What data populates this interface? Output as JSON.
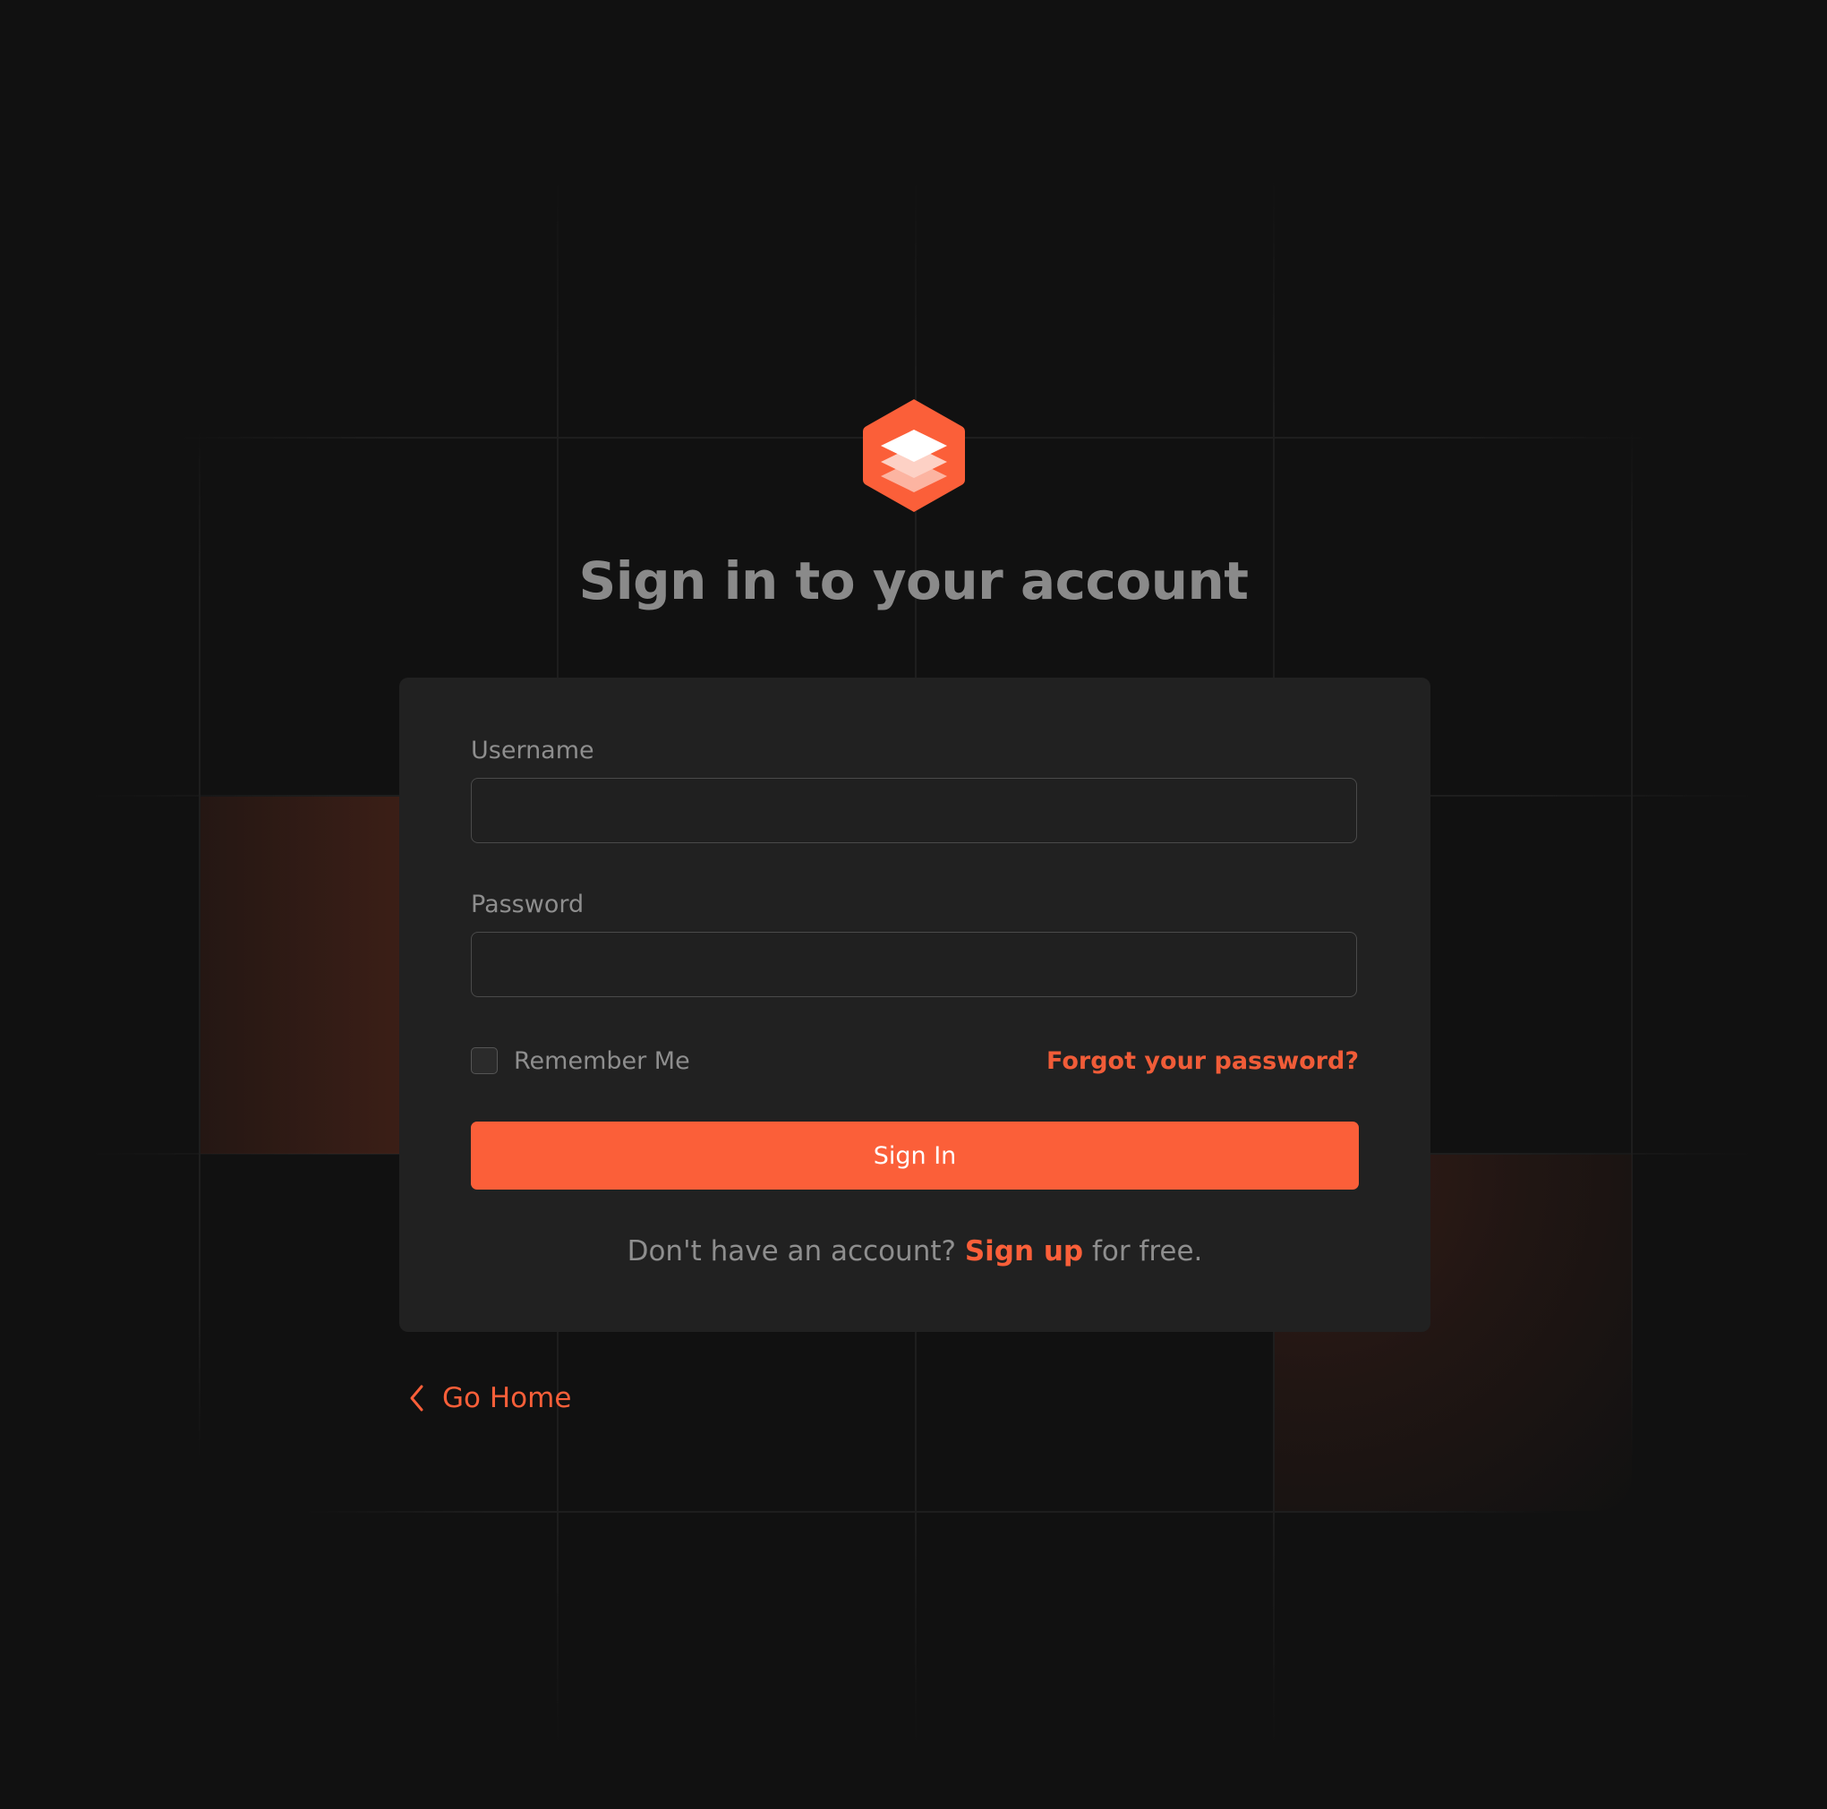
{
  "page": {
    "title": "Sign in to your account"
  },
  "logo": {
    "icon": "stacked-layers-hexagon-icon",
    "color": "#fb5f39"
  },
  "form": {
    "username_label": "Username",
    "username_value": "",
    "password_label": "Password",
    "password_value": "",
    "remember_label": "Remember Me",
    "remember_checked": false,
    "forgot_label": "Forgot your password?",
    "submit_label": "Sign In",
    "signup_prefix": "Don't have an account? ",
    "signup_link": "Sign up",
    "signup_suffix": " for free."
  },
  "footer": {
    "go_home_label": "Go Home",
    "go_home_icon": "chevron-left-icon"
  },
  "colors": {
    "background": "#111111",
    "card": "#212121",
    "accent": "#fb5f39",
    "text_muted": "#8e8e8e"
  }
}
